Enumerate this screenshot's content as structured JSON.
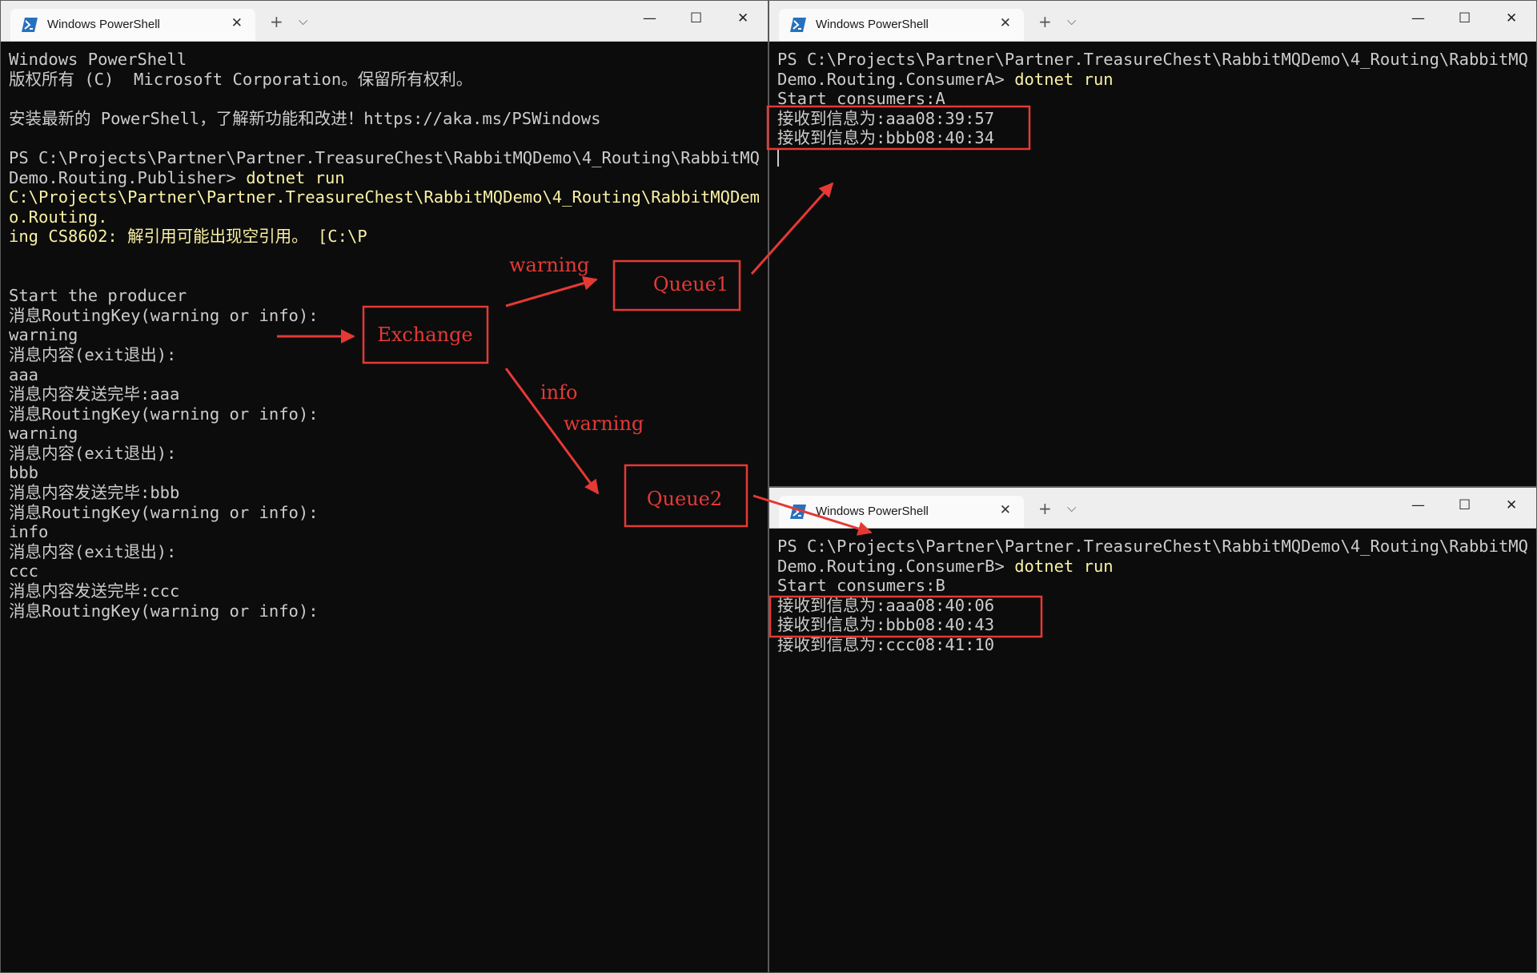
{
  "windows": [
    {
      "id": "publisher",
      "tab_label": "Windows PowerShell",
      "tab_close": "✕",
      "new_tab": "+",
      "dropdown": "⌵",
      "ctrl_min": "—",
      "ctrl_max": "☐",
      "ctrl_close": "✕",
      "lines": [
        {
          "t": "Windows PowerShell"
        },
        {
          "t": "版权所有 (C)  Microsoft Corporation。保留所有权利。"
        },
        {
          "t": ""
        },
        {
          "t": "安装最新的 PowerShell，了解新功能和改进！https://aka.ms/PSWindows"
        },
        {
          "t": ""
        },
        {
          "t": "PS C:\\Projects\\Partner\\Partner.TreasureChest\\RabbitMQDemo\\4_Routing\\RabbitMQ"
        },
        {
          "t": "Demo.Routing.Publisher> ",
          "cmd": "dotnet run"
        },
        {
          "t": "C:\\Projects\\Partner\\Partner.TreasureChest\\RabbitMQDemo\\4_Routing\\RabbitMQDem",
          "y": true
        },
        {
          "t": "o.Routing.",
          "y": true
        },
        {
          "t": "ing CS8602: 解引用可能出现空引用。 [C:\\P",
          "y": true
        },
        {
          "t": ""
        },
        {
          "t": ""
        },
        {
          "t": "Start the producer"
        },
        {
          "t": "消息RoutingKey(warning or info):"
        },
        {
          "t": "warning"
        },
        {
          "t": "消息内容(exit退出):"
        },
        {
          "t": "aaa"
        },
        {
          "t": "消息内容发送完毕:aaa"
        },
        {
          "t": "消息RoutingKey(warning or info):"
        },
        {
          "t": "warning"
        },
        {
          "t": "消息内容(exit退出):"
        },
        {
          "t": "bbb"
        },
        {
          "t": "消息内容发送完毕:bbb"
        },
        {
          "t": "消息RoutingKey(warning or info):"
        },
        {
          "t": "info"
        },
        {
          "t": "消息内容(exit退出):"
        },
        {
          "t": "ccc"
        },
        {
          "t": "消息内容发送完毕:ccc"
        },
        {
          "t": "消息RoutingKey(warning or info):"
        }
      ]
    },
    {
      "id": "consumerA",
      "tab_label": "Windows PowerShell",
      "tab_close": "✕",
      "new_tab": "+",
      "dropdown": "⌵",
      "ctrl_min": "—",
      "ctrl_max": "☐",
      "ctrl_close": "✕",
      "lines": [
        {
          "t": "PS C:\\Projects\\Partner\\Partner.TreasureChest\\RabbitMQDemo\\4_Routing\\RabbitMQ"
        },
        {
          "t": "Demo.Routing.ConsumerA> ",
          "cmd": "dotnet run"
        },
        {
          "t": "Start consumers:A"
        },
        {
          "t": "接收到信息为:aaa08:39:57"
        },
        {
          "t": "接收到信息为:bbb08:40:34"
        },
        {
          "t": "",
          "cursor": true
        }
      ]
    },
    {
      "id": "consumerB",
      "tab_label": "Windows PowerShell",
      "tab_close": "✕",
      "new_tab": "+",
      "dropdown": "⌵",
      "ctrl_min": "—",
      "ctrl_max": "☐",
      "ctrl_close": "✕",
      "lines": [
        {
          "t": "PS C:\\Projects\\Partner\\Partner.TreasureChest\\RabbitMQDemo\\4_Routing\\RabbitMQ"
        },
        {
          "t": "Demo.Routing.ConsumerB> ",
          "cmd": "dotnet run"
        },
        {
          "t": "Start consumers:B"
        },
        {
          "t": "接收到信息为:aaa08:40:06"
        },
        {
          "t": "接收到信息为:bbb08:40:43"
        },
        {
          "t": "接收到信息为:ccc08:41:10"
        }
      ]
    }
  ],
  "annotations": {
    "exchange": "Exchange",
    "queue1": "Queue1",
    "queue2": "Queue2",
    "route_warning_q1": "warning",
    "route_info_q2": "info",
    "route_warning_q2": "warning",
    "color": "#e53935"
  },
  "colors": {
    "terminal_bg": "#0c0c0c",
    "terminal_fg": "#cccccc",
    "warning_fg": "#f9f1a5",
    "titlebar_bg": "#eeeeee"
  }
}
